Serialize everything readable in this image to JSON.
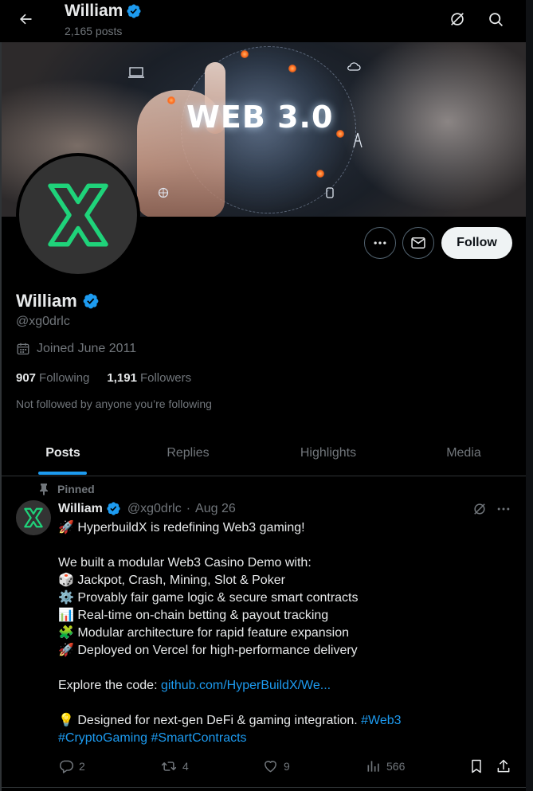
{
  "header": {
    "title": "William",
    "post_count": "2,165 posts"
  },
  "banner": {
    "title": "WEB 3.0"
  },
  "profile": {
    "name": "William",
    "handle": "@xg0drlc",
    "joined": "Joined June 2011",
    "following_count": "907",
    "following_label": "Following",
    "followers_count": "1,191",
    "followers_label": "Followers",
    "not_followed": "Not followed by anyone you’re following",
    "follow_label": "Follow"
  },
  "tabs": [
    {
      "label": "Posts",
      "active": true
    },
    {
      "label": "Replies"
    },
    {
      "label": "Highlights"
    },
    {
      "label": "Media"
    }
  ],
  "post": {
    "pinned_label": "Pinned",
    "author": "William",
    "handle": "@xg0drlc",
    "separator": "·",
    "date": "Aug 26",
    "lines": [
      "🚀 HyperbuildX is redefining Web3 gaming!",
      "",
      "We built a modular Web3 Casino Demo with:",
      "🎲 Jackpot, Crash, Mining, Slot & Poker",
      "⚙️ Provably fair game logic & secure smart contracts",
      "📊 Real-time on-chain betting & payout tracking",
      "🧩 Modular architecture for rapid feature expansion",
      "🚀 Deployed on Vercel for high-performance delivery",
      ""
    ],
    "code_prefix": "Explore the code: ",
    "code_link": "github.com/HyperBuildX/We...",
    "closing_text": "💡 Designed for next-gen DeFi & gaming integration. ",
    "hashtag_1": "#Web3",
    "hashtag_2": "#CryptoGaming",
    "hashtag_3": "#SmartContracts",
    "replies": "2",
    "reposts": "4",
    "likes": "9",
    "views": "566"
  },
  "colors": {
    "accent": "#1d9bf0",
    "verified": "#1d9bf0",
    "logo_green": "#1fd37a"
  },
  "icons": [
    "back-arrow-icon",
    "grok-icon",
    "search-icon",
    "more-icon",
    "mail-icon",
    "verified-icon",
    "calendar-icon",
    "pin-icon",
    "reply-icon",
    "repost-icon",
    "like-icon",
    "views-icon",
    "bookmark-icon",
    "share-icon"
  ]
}
